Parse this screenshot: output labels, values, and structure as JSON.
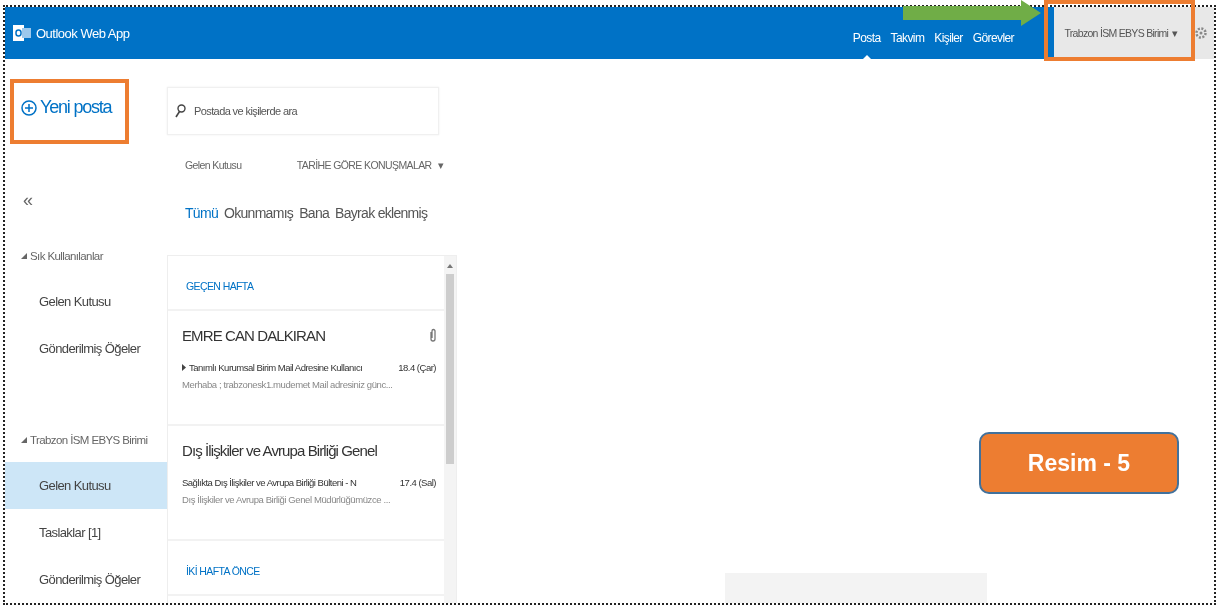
{
  "app": {
    "title": "Outlook Web App"
  },
  "nav": [
    {
      "label": "Posta",
      "selected": true
    },
    {
      "label": "Takvim",
      "selected": false
    },
    {
      "label": "Kişiler",
      "selected": false
    },
    {
      "label": "Görevler",
      "selected": false
    }
  ],
  "account": {
    "name": "Trabzon İSM EBYS Birimi",
    "caret": "▾"
  },
  "new_mail": {
    "label": "Yeni posta"
  },
  "collapse": "«",
  "folder_groups": [
    {
      "label": "Sık Kullanılanlar",
      "expanded": true,
      "children": [
        {
          "label": "Gelen Kutusu",
          "selected": false
        },
        {
          "label": "Gönderilmiş Öğeler",
          "selected": false
        }
      ]
    },
    {
      "label": "Trabzon İSM EBYS Birimi",
      "expanded": true,
      "children": [
        {
          "label": "Gelen Kutusu",
          "selected": true
        },
        {
          "label": "Taslaklar [1]",
          "selected": false
        },
        {
          "label": "Gönderilmiş Öğeler",
          "selected": false
        }
      ]
    }
  ],
  "search": {
    "placeholder": "Postada ve kişilerde ara"
  },
  "list_header": {
    "folder": "Gelen Kutusu",
    "sort": "TARİHE GÖRE KONUŞMALAR",
    "caret": "▾"
  },
  "filters": [
    {
      "label": "Tümü",
      "selected": true
    },
    {
      "label": "Okunmamış",
      "selected": false
    },
    {
      "label": "Bana",
      "selected": false
    },
    {
      "label": "Bayrak eklenmiş",
      "selected": false
    }
  ],
  "message_groups": [
    {
      "heading": "GEÇEN HAFTA",
      "messages": [
        {
          "sender": "EMRE CAN DALKIRAN",
          "subject": "Tanımlı Kurumsal Birim Mail Adresine Kullanıcı",
          "date": "18.4 (Çar)",
          "preview": "Merhaba ; trabzonesk1.mudemet Mail adresiniz günc...",
          "has_attachment": true,
          "conversation": true
        },
        {
          "sender": "Dış İlişkiler ve Avrupa Birliği Genel",
          "subject": "Sağlıkta Dış İlişkiler ve Avrupa Birliği Bülteni - N",
          "date": "17.4 (Sal)",
          "preview": "Dış İlişkiler ve Avrupa Birliği Genel Müdürlüğümüzce ...",
          "has_attachment": false,
          "conversation": false
        }
      ]
    },
    {
      "heading": "İKİ HAFTA ÖNCE"
    }
  ],
  "annotation": {
    "label": "Resim - 5"
  }
}
